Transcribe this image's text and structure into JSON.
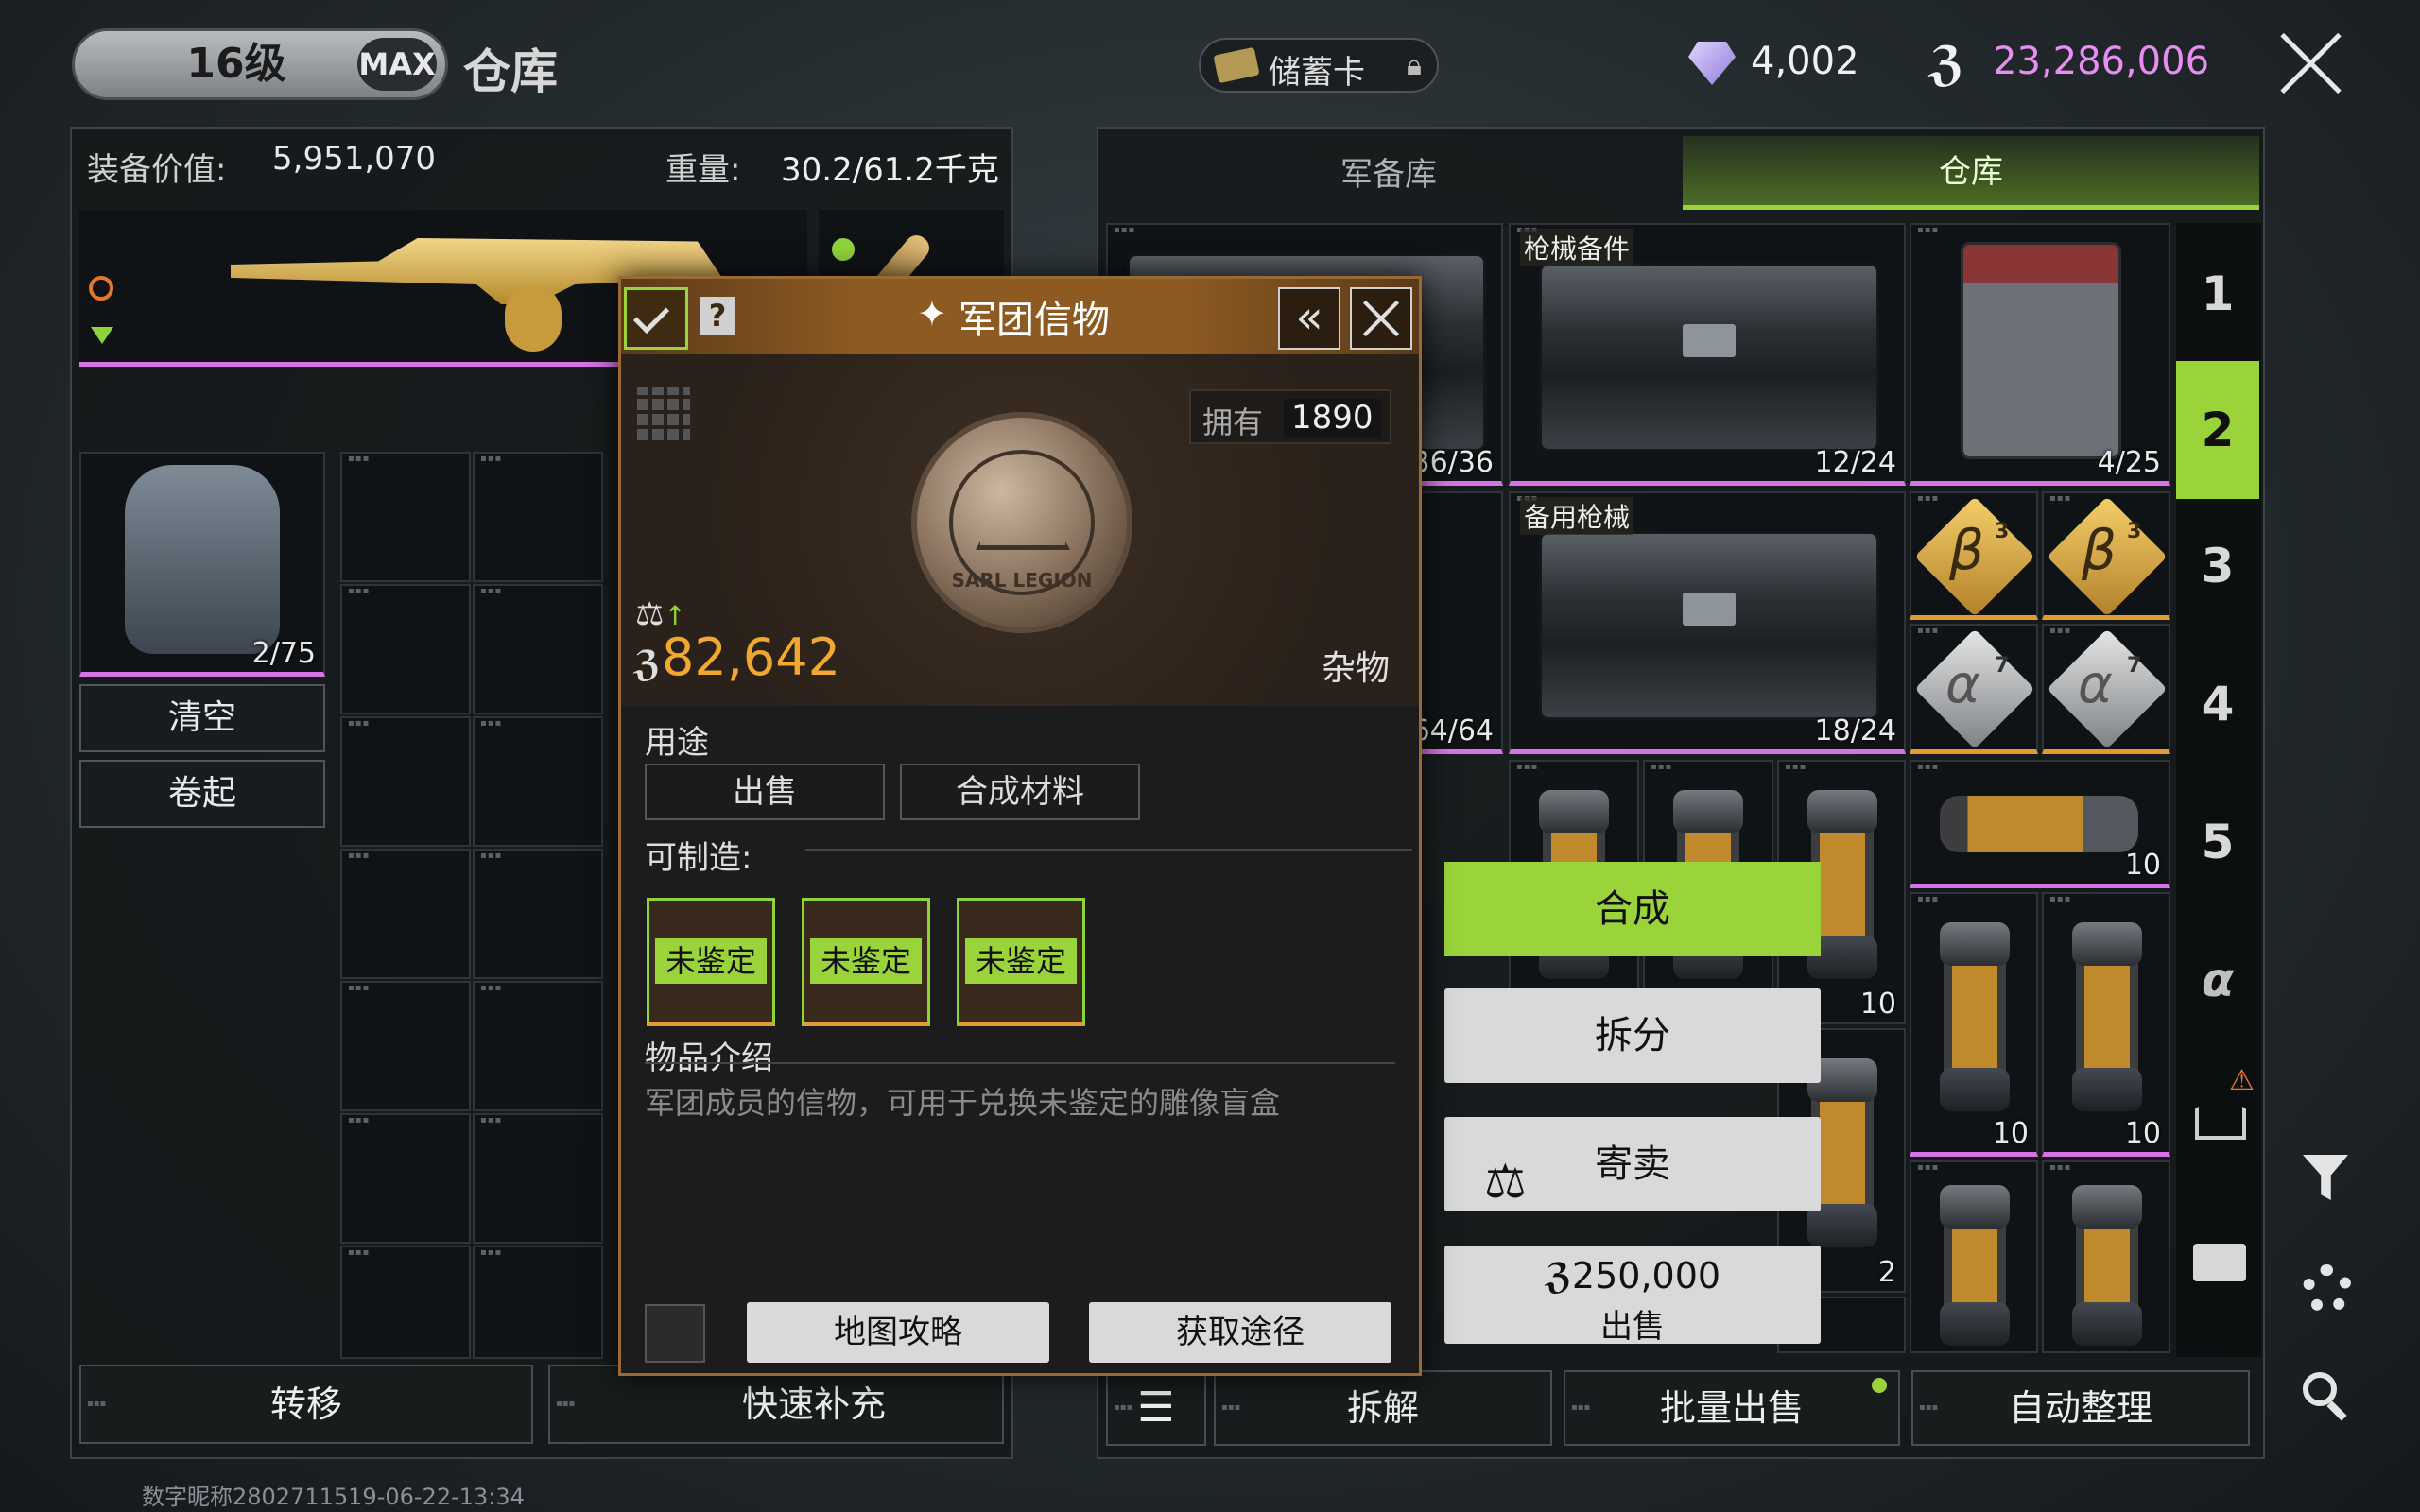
{
  "header": {
    "level": "16级",
    "max_badge": "MAX",
    "title": "仓库",
    "savings_card": "储蓄卡",
    "diamonds": "4,002",
    "coins": "23,286,006",
    "coin_color": "#e88ef0",
    "accent": "#9ad43a"
  },
  "left_panel": {
    "equip_value_label": "装备价值:",
    "equip_value": "5,951,070",
    "weight_label": "重量:",
    "weight": "30.2/61.2千克",
    "backpack_count": "2/75",
    "clear_btn": "清空",
    "roll_btn": "卷起",
    "transfer_btn": "转移",
    "quick_refill_btn": "快速补充"
  },
  "right_panel": {
    "tabs": [
      {
        "label": "军备库",
        "active": false
      },
      {
        "label": "仓库",
        "active": true
      }
    ],
    "side_tabs": [
      "1",
      "2",
      "3",
      "4",
      "5",
      "α"
    ],
    "active_side_tab": "2",
    "cells": {
      "c1_count": "36/36",
      "gun_parts_label": "枪械备件",
      "gun_parts_count": "12/24",
      "crate_count": "4/25",
      "spare_guns_label": "备用枪械",
      "spare_guns_count": "18/24",
      "c_left2_count": "64/64",
      "beta_level": "3",
      "alpha_level": "7",
      "mag_h_count": "10",
      "mag_a_count": "10",
      "mag_b_count": "10",
      "mag_c_count": "10",
      "mag_d_count": "2"
    },
    "bottom": {
      "dismantle": "拆解",
      "batch_sell": "批量出售",
      "auto_sort": "自动整理"
    }
  },
  "context_menu": {
    "craft": "合成",
    "split": "拆分",
    "consign": "寄卖",
    "price": "250,000",
    "sell": "出售"
  },
  "item_popup": {
    "title": "军团信物",
    "own_label": "拥有",
    "own_count": "1890",
    "price": "82,642",
    "category": "杂物",
    "usage_label": "用途",
    "usage_tags": [
      "出售",
      "合成材料"
    ],
    "craftable_label": "可制造:",
    "craftable_items": [
      "未鉴定",
      "未鉴定",
      "未鉴定"
    ],
    "intro_label": "物品介绍",
    "description": "军团成员的信物，可用于兑换未鉴定的雕像盲盒",
    "coin_text": "SARL LEGION",
    "map_guide": "地图攻略",
    "get_path": "获取途径"
  },
  "footer": {
    "watermark": "数字昵称2802711519-06-22-13:34"
  }
}
